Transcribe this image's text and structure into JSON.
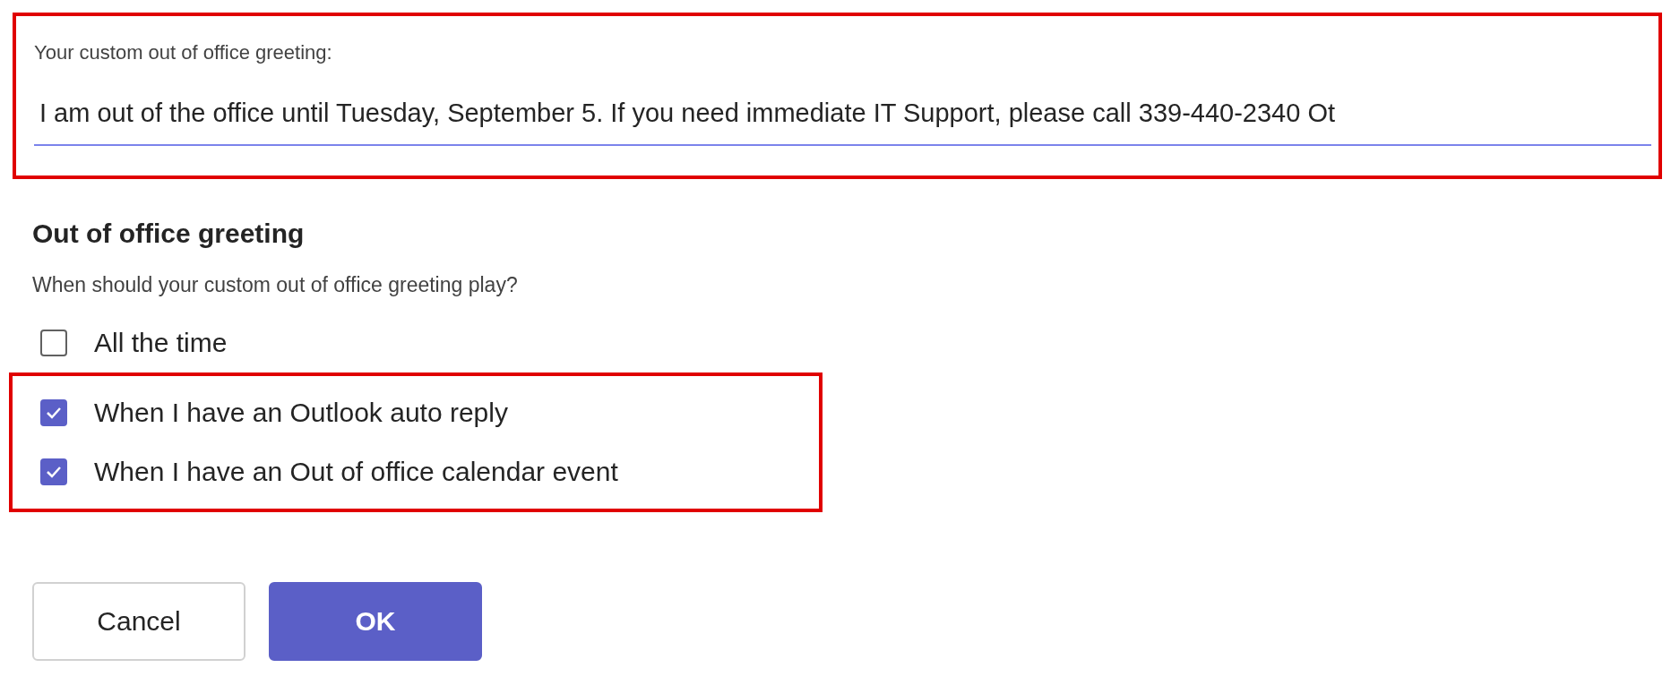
{
  "greeting_field": {
    "label": "Your custom out of office greeting:",
    "value": "I am out of the office until Tuesday, September 5. If you need immediate IT Support, please call 339-440-2340 Ot"
  },
  "section": {
    "title": "Out of office greeting",
    "subtitle": "When should your custom out of office greeting play?"
  },
  "options": [
    {
      "label": "All the time",
      "checked": false
    },
    {
      "label": "When I have an Outlook auto reply",
      "checked": true
    },
    {
      "label": "When I have an Out of office calendar event",
      "checked": true
    }
  ],
  "buttons": [
    {
      "label": "Cancel",
      "kind": "secondary"
    },
    {
      "label": "OK",
      "kind": "primary"
    }
  ]
}
